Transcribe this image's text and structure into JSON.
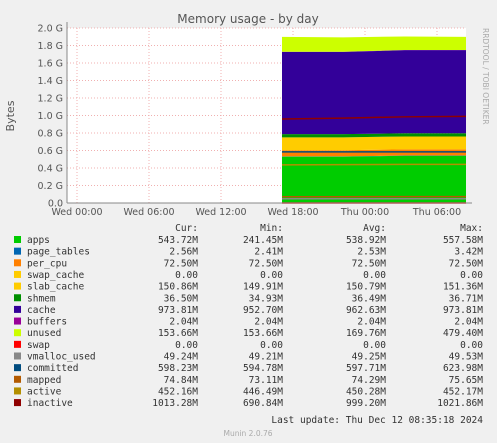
{
  "colors": {
    "apps": "#00cc00",
    "page_tables": "#0066b3",
    "per_cpu": "#ff8000",
    "swap_cache": "#ffcc00",
    "slab_cache": "#ffcc00",
    "shmem": "#008f00",
    "cache": "#330099",
    "buffers": "#990099",
    "unused": "#ccff00",
    "swap": "#ff0000",
    "vmalloc_used": "#888888",
    "committed": "#004c7f",
    "mapped": "#b35a00",
    "active": "#b38f00",
    "inactive": "#8f0000"
  },
  "chart_data": {
    "type": "area",
    "title": "Memory usage - by day",
    "ylabel": "Bytes",
    "xlabel": "",
    "ylim": [
      0,
      2.0
    ],
    "y_unit": "G",
    "y_ticks": [
      "0.0",
      "0.2 G",
      "0.4 G",
      "0.6 G",
      "0.8 G",
      "1.0 G",
      "1.2 G",
      "1.4 G",
      "1.6 G",
      "1.8 G",
      "2.0 G"
    ],
    "x_ticks": [
      "Wed 00:00",
      "Wed 06:00",
      "Wed 12:00",
      "Wed 18:00",
      "Thu 00:00",
      "Thu 06:00"
    ],
    "data_starts_near": "Wed 18:00",
    "side_label": "RRDTOOL / TOBI OETIKER",
    "legend_headers": [
      "Cur:",
      "Min:",
      "Avg:",
      "Max:"
    ],
    "series": [
      {
        "name": "apps",
        "stacked": true,
        "cur": "543.72M",
        "min": "241.45M",
        "avg": "538.92M",
        "max": "557.58M",
        "values_g": [
          0.53,
          0.53,
          0.54,
          0.54
        ]
      },
      {
        "name": "page_tables",
        "stacked": true,
        "cur": "2.56M",
        "min": "2.41M",
        "avg": "2.53M",
        "max": "3.42M",
        "values_g": [
          0.0025,
          0.0025,
          0.0025,
          0.0025
        ]
      },
      {
        "name": "per_cpu",
        "stacked": true,
        "cur": "72.50M",
        "min": "72.50M",
        "avg": "72.50M",
        "max": "72.50M",
        "values_g": [
          0.071,
          0.071,
          0.071,
          0.071
        ]
      },
      {
        "name": "swap_cache",
        "stacked": true,
        "cur": "0.00",
        "min": "0.00",
        "avg": "0.00",
        "max": "0.00",
        "values_g": [
          0,
          0,
          0,
          0
        ]
      },
      {
        "name": "slab_cache",
        "stacked": true,
        "cur": "150.86M",
        "min": "149.91M",
        "avg": "150.79M",
        "max": "151.36M",
        "values_g": [
          0.147,
          0.147,
          0.147,
          0.147
        ]
      },
      {
        "name": "shmem",
        "stacked": true,
        "cur": "36.50M",
        "min": "34.93M",
        "avg": "36.49M",
        "max": "36.71M",
        "values_g": [
          0.036,
          0.036,
          0.036,
          0.036
        ]
      },
      {
        "name": "cache",
        "stacked": true,
        "cur": "973.81M",
        "min": "952.70M",
        "avg": "962.63M",
        "max": "973.81M",
        "values_g": [
          0.94,
          0.94,
          0.95,
          0.95
        ]
      },
      {
        "name": "buffers",
        "stacked": true,
        "cur": "2.04M",
        "min": "2.04M",
        "avg": "2.04M",
        "max": "2.04M",
        "values_g": [
          0.002,
          0.002,
          0.002,
          0.002
        ]
      },
      {
        "name": "unused",
        "stacked": true,
        "cur": "153.66M",
        "min": "153.66M",
        "avg": "169.76M",
        "max": "479.40M",
        "values_g": [
          0.17,
          0.165,
          0.155,
          0.15
        ]
      },
      {
        "name": "swap",
        "stacked": false,
        "cur": "0.00",
        "min": "0.00",
        "avg": "0.00",
        "max": "0.00",
        "values_g": [
          0,
          0,
          0,
          0
        ]
      },
      {
        "name": "vmalloc_used",
        "stacked": false,
        "cur": "49.24M",
        "min": "49.21M",
        "avg": "49.25M",
        "max": "49.53M",
        "values_g": [
          0.048,
          0.048,
          0.048,
          0.048
        ]
      },
      {
        "name": "committed",
        "stacked": false,
        "cur": "598.23M",
        "min": "594.78M",
        "avg": "597.71M",
        "max": "623.98M",
        "values_g": [
          0.585,
          0.584,
          0.585,
          0.585
        ]
      },
      {
        "name": "mapped",
        "stacked": false,
        "cur": "74.84M",
        "min": "73.11M",
        "avg": "74.29M",
        "max": "75.65M",
        "values_g": [
          0.072,
          0.072,
          0.073,
          0.073
        ]
      },
      {
        "name": "active",
        "stacked": false,
        "cur": "452.16M",
        "min": "446.49M",
        "avg": "450.28M",
        "max": "452.17M",
        "values_g": [
          0.436,
          0.438,
          0.441,
          0.442
        ]
      },
      {
        "name": "inactive",
        "stacked": false,
        "cur": "1013.28M",
        "min": "690.84M",
        "avg": "999.20M",
        "max": "1021.86M",
        "values_g": [
          0.96,
          0.97,
          0.985,
          0.99
        ]
      }
    ],
    "last_update": "Last update: Thu Dec 12 08:35:18 2024",
    "footer": "Munin 2.0.76"
  }
}
